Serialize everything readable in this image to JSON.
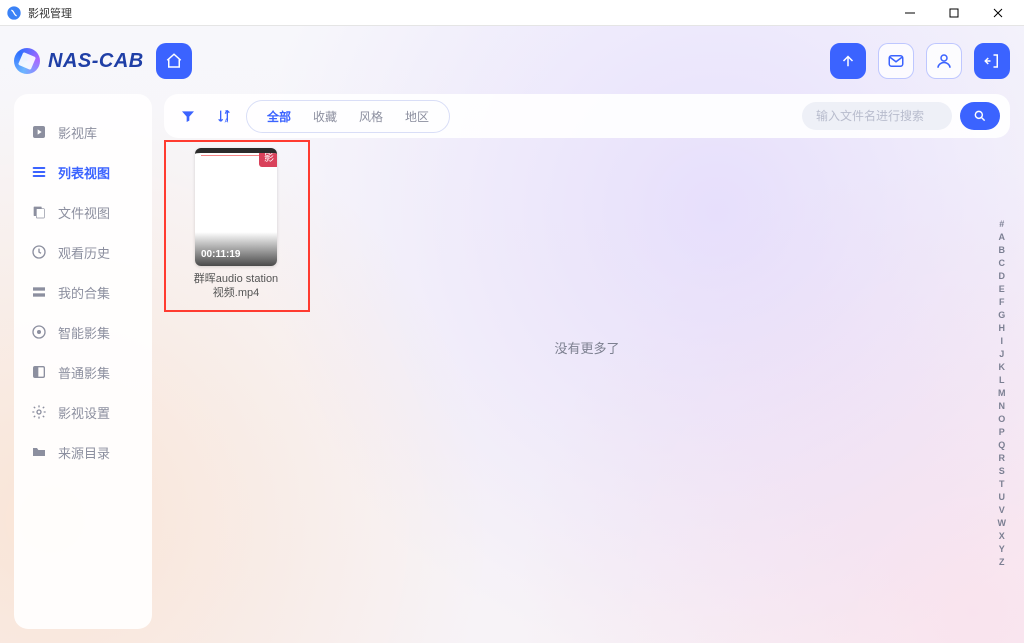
{
  "window": {
    "title": "影视管理"
  },
  "brand": "NAS-CAB",
  "sidebar": {
    "items": [
      {
        "label": "影视库"
      },
      {
        "label": "列表视图"
      },
      {
        "label": "文件视图"
      },
      {
        "label": "观看历史"
      },
      {
        "label": "我的合集"
      },
      {
        "label": "智能影集"
      },
      {
        "label": "普通影集"
      },
      {
        "label": "影视设置"
      },
      {
        "label": "来源目录"
      }
    ],
    "active_index": 1
  },
  "filters": {
    "tabs": [
      "全部",
      "收藏",
      "风格",
      "地区"
    ],
    "active_index": 0
  },
  "search": {
    "placeholder": "输入文件名进行搜索"
  },
  "items": [
    {
      "badge": "影",
      "duration": "00:11:19",
      "filename": "群晖audio station视频.mp4"
    }
  ],
  "empty_text": "没有更多了",
  "alpha_index": [
    "#",
    "A",
    "B",
    "C",
    "D",
    "E",
    "F",
    "G",
    "H",
    "I",
    "J",
    "K",
    "L",
    "M",
    "N",
    "O",
    "P",
    "Q",
    "R",
    "S",
    "T",
    "U",
    "V",
    "W",
    "X",
    "Y",
    "Z"
  ]
}
